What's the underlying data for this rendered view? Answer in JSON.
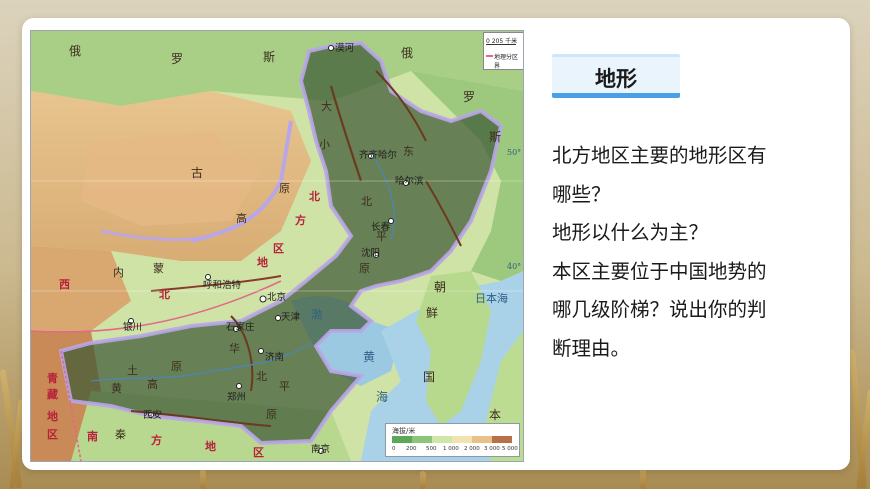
{
  "header": {
    "title": "地形"
  },
  "question_lines": [
    "北方地区主要的地形区有",
    "哪些？",
    "地形以什么为主？",
    "本区主要位于中国地势的",
    "哪几级阶梯？说出你的判",
    "断理由。"
  ],
  "map": {
    "scale_text": "0    205 千米",
    "boundary_legend": "地理分区界",
    "elevation_legend": {
      "title": "海拔/米",
      "colors": [
        "#5ba85a",
        "#8cc57a",
        "#cfe6a8",
        "#f2e2b0",
        "#e9c08a",
        "#d49a63",
        "#b87046"
      ],
      "ticks": [
        "0",
        "200",
        "500",
        "1 000",
        "2 000",
        "3 000",
        "5 000"
      ]
    },
    "labels": {
      "eluosi_1": "俄",
      "eluosi_2": "罗",
      "eluosi_3": "斯",
      "eluosi_right_1": "俄",
      "eluosi_right_2": "罗",
      "eluosi_right_3": "斯",
      "menggu": "古",
      "gaoyuan_1": "高",
      "gaoyuan_2": "原",
      "neimeng_1": "内",
      "neimeng_2": "蒙",
      "huhehaote": "呼和浩特",
      "xibei_1": "西",
      "xibei_2": "北",
      "beifang_1": "北",
      "beifang_2": "方",
      "beifang_3": "地",
      "beifang_4": "区",
      "xiaoxingan": "小",
      "daxinganling": "大",
      "dongbei": "东",
      "dongbei_2": "北",
      "pingyuan_1": "平",
      "pingyuan_2": "原",
      "changchun": "长春",
      "shenyang": "沈阳",
      "haerbin": "哈尔滨",
      "qiqihaer": "齐齐哈尔",
      "mohe": "漠河",
      "beijing": "北京",
      "tianjin": "天津",
      "shijiazhuang": "石家庄",
      "jinan": "济南",
      "zhengzhou": "郑州",
      "xian": "西安",
      "nanjing": "南京",
      "yinchuan": "银川",
      "chaoxian_1": "朝",
      "chaoxian_2": "鲜",
      "hanguo": "国",
      "riben": "本",
      "ribenhai": "日本海",
      "huanghai": "黄",
      "huanghai_2": "海",
      "bohai": "渤",
      "huabei_1": "华",
      "huabei_2": "北",
      "huabei_3": "平",
      "huabei_4": "原",
      "huangtu_1": "黄",
      "huangtu_2": "土",
      "huangtu_3": "高",
      "huangtu_4": "原",
      "nanfang_1": "南",
      "nanfang_2": "方",
      "nanfang_3": "地",
      "nanfang_4": "区",
      "qingzang_1": "青",
      "qingzang_2": "藏",
      "qingzang_3": "地",
      "qingzang_4": "区",
      "qinling": "秦",
      "lat_40": "40°",
      "lat_50": "50°"
    }
  }
}
